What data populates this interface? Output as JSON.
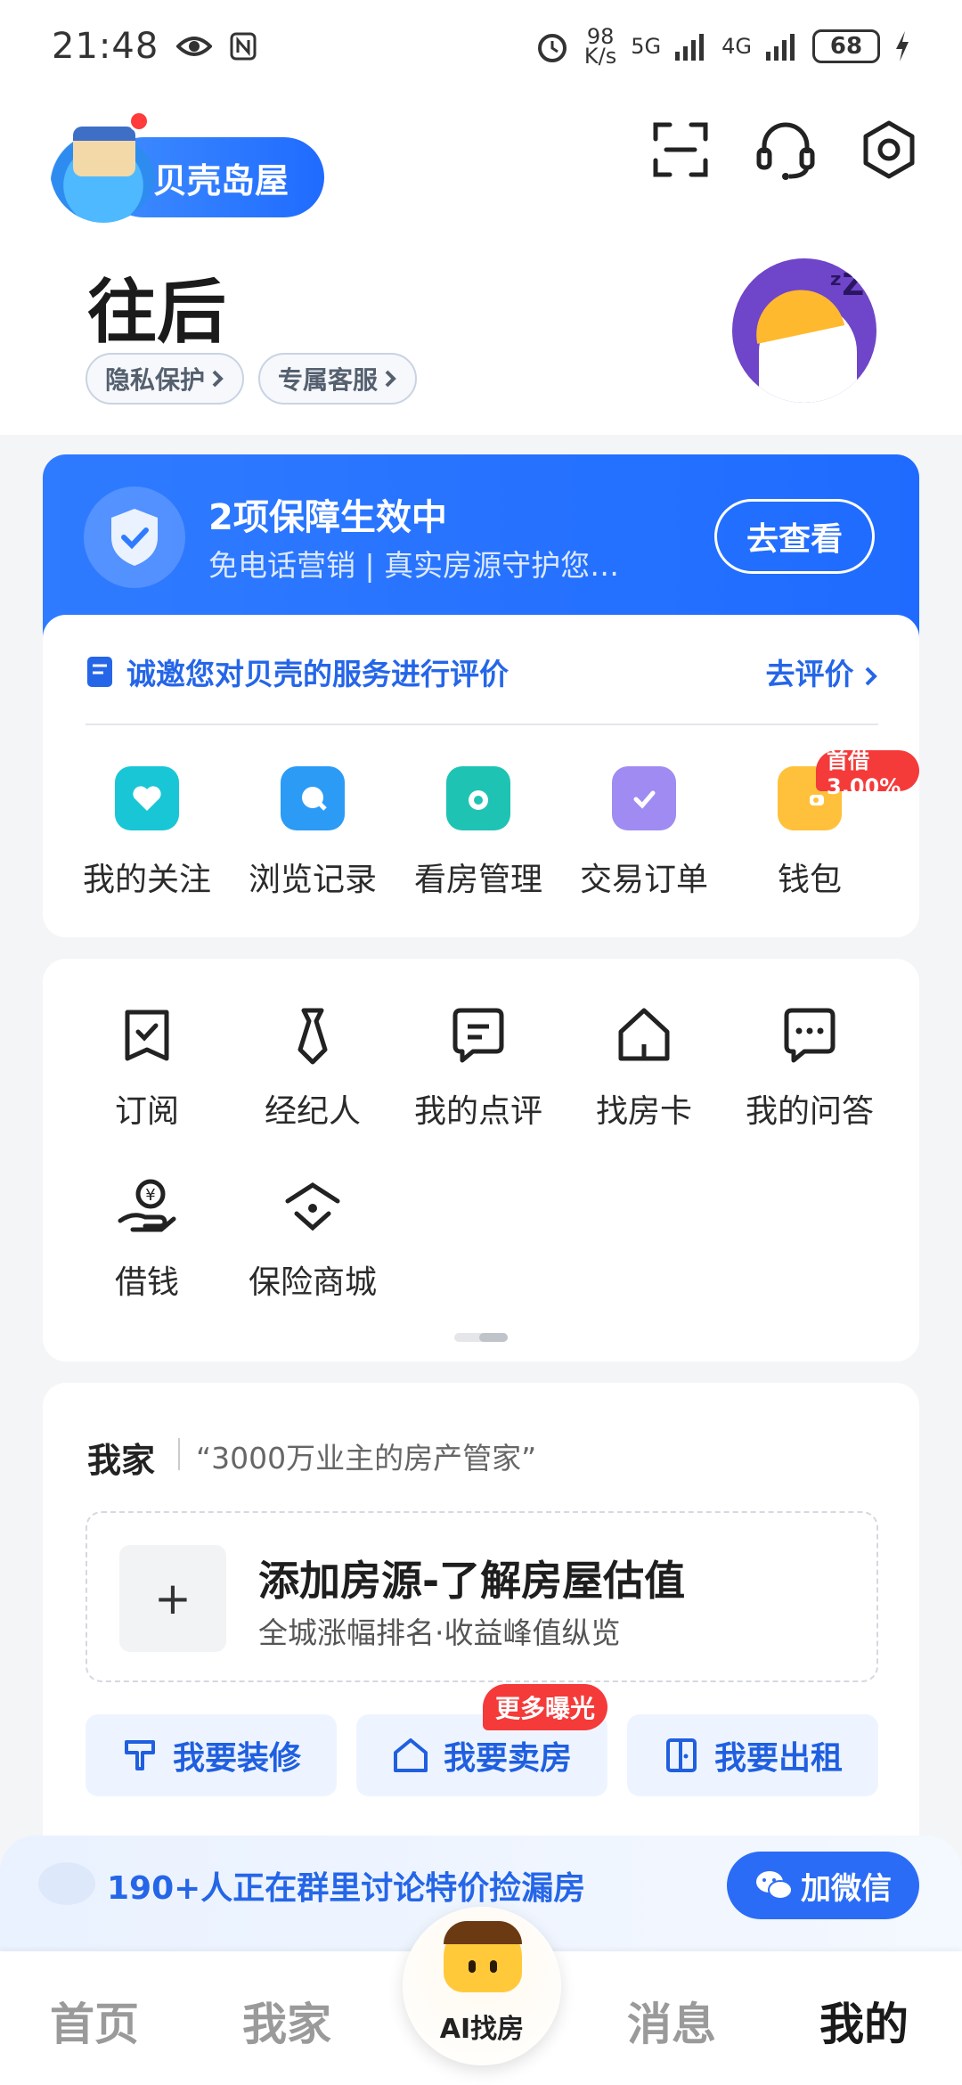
{
  "status_bar": {
    "time": "21:48",
    "net_speed_top": "98",
    "net_speed_unit": "K/s",
    "sig1": "5G",
    "sig2": "4G",
    "battery": "68"
  },
  "header": {
    "brand": "贝壳岛屋",
    "user_name": "往后",
    "chips": [
      "隐私保护",
      "专属客服"
    ]
  },
  "protection": {
    "title": "2项保障生效中",
    "subtitle": "免电话营销 | 真实房源守护您…",
    "button": "去查看"
  },
  "service": {
    "review_text": "诚邀您对贝壳的服务进行评价",
    "review_link": "去评价",
    "items": [
      {
        "label": "我的关注",
        "icon": "heart-folder-icon",
        "color": "#19c6d6"
      },
      {
        "label": "浏览记录",
        "icon": "search-bubble-icon",
        "color": "#2b9bf6"
      },
      {
        "label": "看房管理",
        "icon": "eye-folder-icon",
        "color": "#1fc3b3"
      },
      {
        "label": "交易订单",
        "icon": "check-clipboard-icon",
        "color": "#a08bf2"
      },
      {
        "label": "钱包",
        "icon": "wallet-icon",
        "color": "#ffc13b"
      }
    ],
    "loan_badge": "首借3.00%"
  },
  "tools": {
    "items": [
      {
        "label": "订阅",
        "icon": "subscribe-icon"
      },
      {
        "label": "经纪人",
        "icon": "agent-tie-icon"
      },
      {
        "label": "我的点评",
        "icon": "comment-icon"
      },
      {
        "label": "找房卡",
        "icon": "house-card-icon"
      },
      {
        "label": "我的问答",
        "icon": "qa-bubble-icon"
      },
      {
        "label": "借钱",
        "icon": "borrow-money-icon"
      },
      {
        "label": "保险商城",
        "icon": "insurance-icon"
      }
    ]
  },
  "home": {
    "title": "我家",
    "quote": "“3000万业主的房产管家”",
    "add_title": "添加房源-了解房屋估值",
    "add_sub": "全城涨幅排名·收益峰值纵览",
    "actions": [
      "我要装修",
      "我要卖房",
      "我要出租"
    ],
    "more_badge": "更多曝光"
  },
  "banner": {
    "text": "190+人正在群里讨论特价捡漏房",
    "button": "加微信"
  },
  "tabbar": {
    "tabs": [
      "首页",
      "我家",
      "消息",
      "我的"
    ],
    "ai_label": "AI找房"
  }
}
